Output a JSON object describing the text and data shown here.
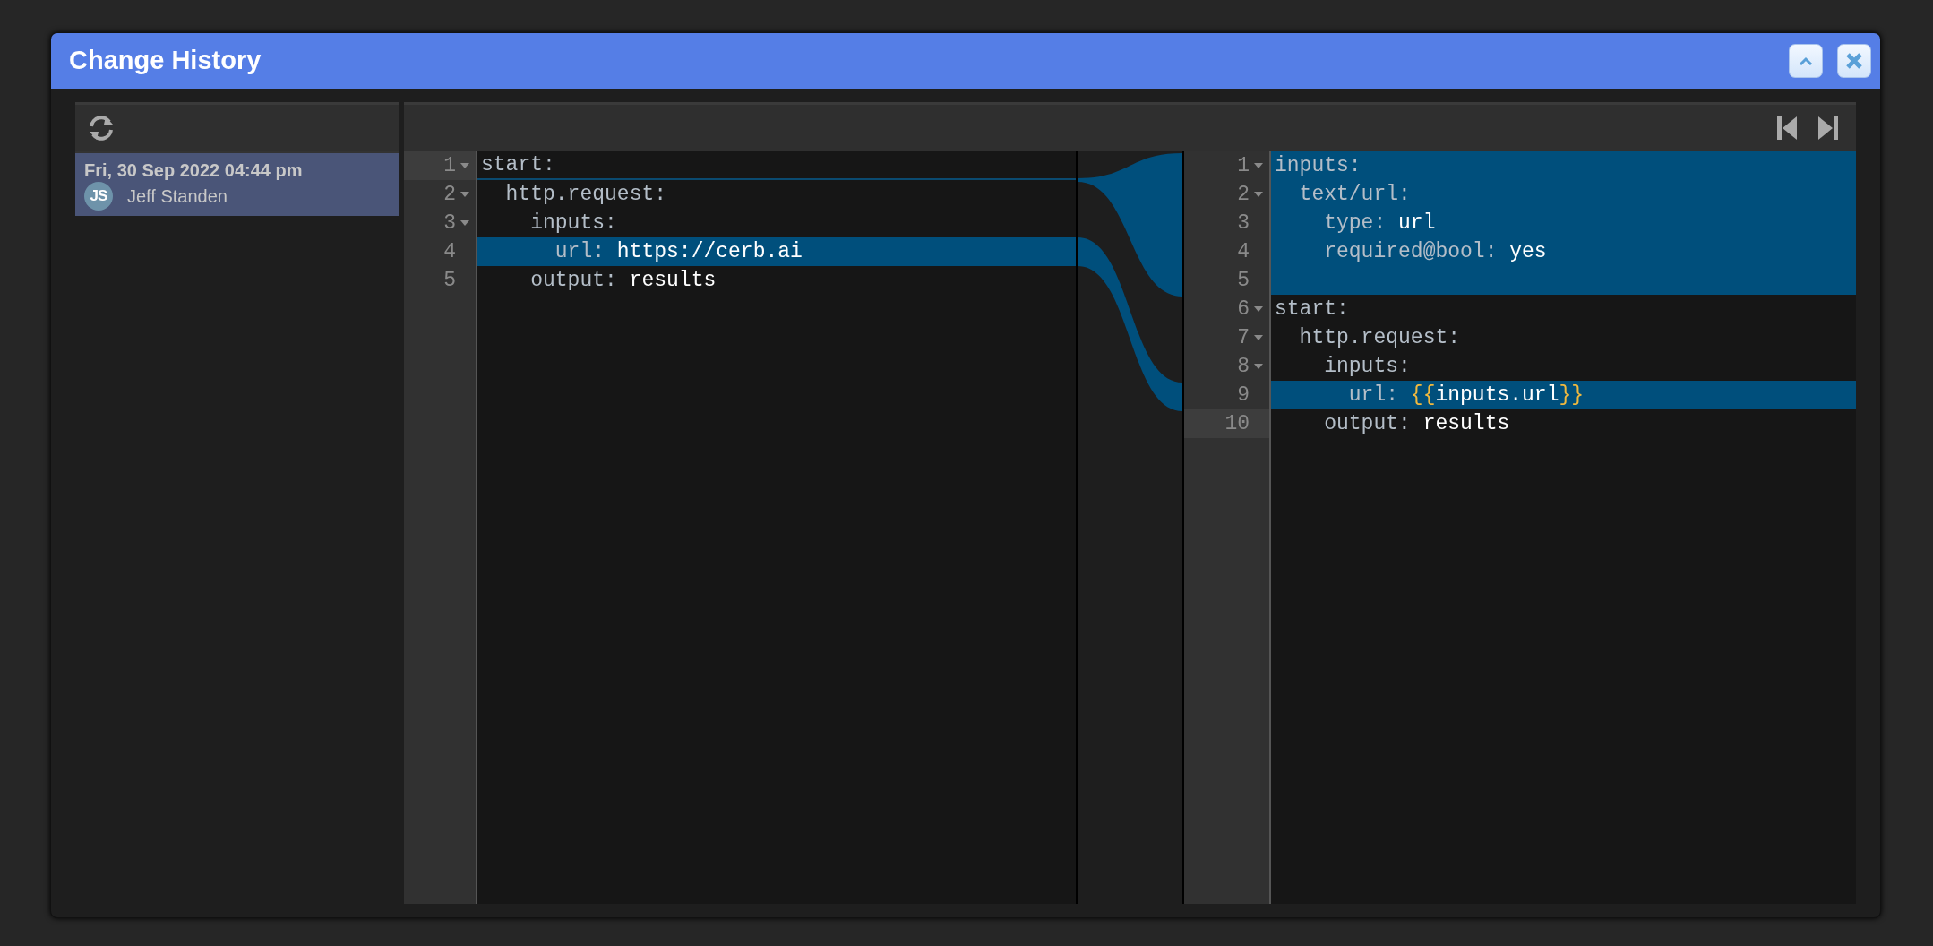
{
  "window": {
    "title": "Change History",
    "buttons": [
      {
        "kind": "collapse"
      },
      {
        "kind": "close"
      }
    ]
  },
  "history": {
    "items": [
      {
        "date": "Fri, 30 Sep 2022 04:44 pm",
        "author": "Jeff Standen",
        "initials": "JS",
        "selected": true
      }
    ]
  },
  "diff": {
    "left": {
      "lines": [
        {
          "number": "1",
          "foldable": true,
          "current": true,
          "highlighted": false,
          "insertion_below": true,
          "tokens": [
            {
              "kind": "key",
              "text": "start:"
            }
          ]
        },
        {
          "number": "2",
          "foldable": true,
          "current": false,
          "highlighted": false,
          "insertion_below": false,
          "tokens": [
            {
              "kind": "key",
              "text": "  http.request:"
            }
          ]
        },
        {
          "number": "3",
          "foldable": true,
          "current": false,
          "highlighted": false,
          "insertion_below": false,
          "tokens": [
            {
              "kind": "key",
              "text": "    inputs:"
            }
          ]
        },
        {
          "number": "4",
          "foldable": false,
          "current": false,
          "highlighted": true,
          "insertion_below": false,
          "tokens": [
            {
              "kind": "key",
              "text": "      url:"
            },
            {
              "kind": "value",
              "text": "https://cerb.ai"
            }
          ]
        },
        {
          "number": "5",
          "foldable": false,
          "current": false,
          "highlighted": false,
          "insertion_below": false,
          "tokens": [
            {
              "kind": "key",
              "text": "    output:"
            },
            {
              "kind": "value",
              "text": "results"
            }
          ]
        }
      ]
    },
    "right": {
      "lines": [
        {
          "number": "1",
          "foldable": true,
          "current": false,
          "highlighted": true,
          "insertion_below": false,
          "tokens": [
            {
              "kind": "key",
              "text": "inputs:"
            }
          ]
        },
        {
          "number": "2",
          "foldable": true,
          "current": false,
          "highlighted": true,
          "insertion_below": false,
          "tokens": [
            {
              "kind": "key",
              "text": "  text/url:"
            }
          ]
        },
        {
          "number": "3",
          "foldable": false,
          "current": false,
          "highlighted": true,
          "insertion_below": false,
          "tokens": [
            {
              "kind": "key",
              "text": "    type:"
            },
            {
              "kind": "value",
              "text": "url"
            }
          ]
        },
        {
          "number": "4",
          "foldable": false,
          "current": false,
          "highlighted": true,
          "insertion_below": false,
          "tokens": [
            {
              "kind": "key",
              "text": "    required@bool:"
            },
            {
              "kind": "value",
              "text": "yes"
            }
          ]
        },
        {
          "number": "5",
          "foldable": false,
          "current": false,
          "highlighted": true,
          "insertion_below": false
        },
        {
          "number": "6",
          "foldable": true,
          "current": false,
          "highlighted": false,
          "insertion_below": false,
          "tokens": [
            {
              "kind": "key",
              "text": "start:"
            }
          ]
        },
        {
          "number": "7",
          "foldable": true,
          "current": false,
          "highlighted": false,
          "insertion_below": false,
          "tokens": [
            {
              "kind": "key",
              "text": "  http.request:"
            }
          ]
        },
        {
          "number": "8",
          "foldable": true,
          "current": false,
          "highlighted": false,
          "insertion_below": false,
          "tokens": [
            {
              "kind": "key",
              "text": "    inputs:"
            }
          ]
        },
        {
          "number": "9",
          "foldable": false,
          "current": false,
          "highlighted": true,
          "insertion_below": false,
          "tokens": [
            {
              "kind": "key",
              "text": "      url:"
            },
            {
              "kind": "brace",
              "text": "{{"
            },
            {
              "kind": "value",
              "text": "inputs.url"
            },
            {
              "kind": "brace",
              "text": "}}"
            }
          ]
        },
        {
          "number": "10",
          "foldable": false,
          "current": true,
          "highlighted": false,
          "insertion_below": false,
          "tokens": [
            {
              "kind": "key",
              "text": "    output:"
            },
            {
              "kind": "value",
              "text": "results"
            }
          ]
        }
      ]
    }
  }
}
